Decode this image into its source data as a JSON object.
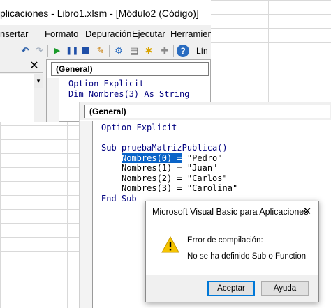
{
  "window": {
    "title": "plicaciones - Libro1.xlsm - [Módulo2 (Código)]"
  },
  "menu": {
    "items": [
      "nsertar",
      "Formato",
      "Depuración",
      "Ejecutar",
      "Herramient"
    ]
  },
  "toolbar": {
    "icons": [
      "undo-icon",
      "redo-icon",
      "run-icon",
      "pause-icon",
      "stop-icon",
      "design-mode-icon",
      "project-explorer-icon",
      "properties-icon",
      "object-browser-icon",
      "toolbox-icon",
      "help-icon"
    ],
    "trailing_label": "Lín"
  },
  "project_panel": {
    "close_glyph": "✕"
  },
  "back_code": {
    "combo": "(General)",
    "lines": [
      "Option Explicit",
      "Dim Nombres(3) As String"
    ]
  },
  "front_code": {
    "combo": "(General)",
    "line_option": "Option Explicit",
    "sub_line": "Sub pruebaMatrizPublica()",
    "selected_text": "Nombres(0) =",
    "line0_rest": " \"Pedro\"",
    "line1": "Nombres(1) = \"Juan\"",
    "line2": "Nombres(2) = \"Carlos\"",
    "line3": "Nombres(3) = \"Carolina\"",
    "end_sub": "End Sub"
  },
  "dialog": {
    "title": "Microsoft Visual Basic para Aplicaciones",
    "close_glyph": "✕",
    "heading": "Error de compilación:",
    "message": "No se ha definido Sub o Function",
    "ok_label": "Aceptar",
    "help_label": "Ayuda"
  },
  "colors": {
    "keyword": "#00007f",
    "selection": "#0a64c8",
    "warning": "#f5c400"
  }
}
